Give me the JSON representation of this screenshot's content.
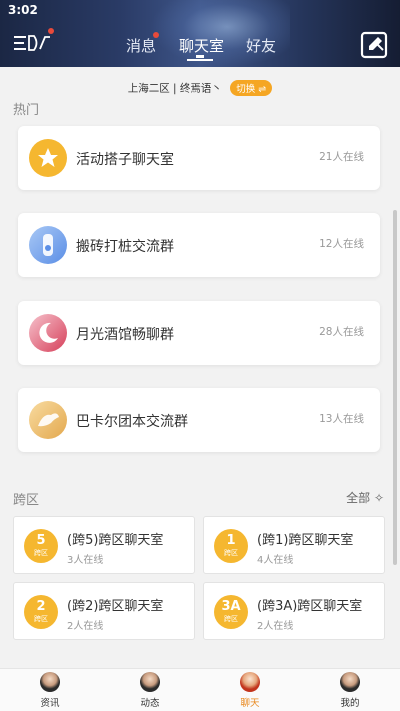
{
  "status_bar": {
    "time": "3:02"
  },
  "header": {
    "tabs": [
      {
        "label": "消息",
        "has_dot": true
      },
      {
        "label": "聊天室",
        "active": true
      },
      {
        "label": "好友"
      }
    ]
  },
  "server": {
    "text": "上海二区 | 终焉语丶",
    "switch_label": "切换 ⇌"
  },
  "hot": {
    "title": "热门",
    "rooms": [
      {
        "name": "活动搭子聊天室",
        "online": "21人在线",
        "icon": "star-icon"
      },
      {
        "name": "搬砖打桩交流群",
        "online": "12人在线",
        "icon": "potion-icon"
      },
      {
        "name": "月光酒馆畅聊群",
        "online": "28人在线",
        "icon": "moon-icon"
      },
      {
        "name": "巴卡尔团本交流群",
        "online": "13人在线",
        "icon": "dragon-icon"
      }
    ]
  },
  "cross": {
    "title": "跨区",
    "see_all": "全部 ✧",
    "rooms": [
      {
        "badge": "5",
        "badge_sub": "跨区",
        "name": "(跨5)跨区聊天室",
        "online": "3人在线"
      },
      {
        "badge": "1",
        "badge_sub": "跨区",
        "name": "(跨1)跨区聊天室",
        "online": "4人在线"
      },
      {
        "badge": "2",
        "badge_sub": "跨区",
        "name": "(跨2)跨区聊天室",
        "online": "2人在线"
      },
      {
        "badge": "3A",
        "badge_sub": "跨区",
        "name": "(跨3A)跨区聊天室",
        "online": "2人在线"
      }
    ]
  },
  "bottom_nav": [
    {
      "label": "资讯"
    },
    {
      "label": "动态"
    },
    {
      "label": "聊天",
      "active": true
    },
    {
      "label": "我的"
    }
  ],
  "colors": {
    "accent": "#f5b730",
    "active_nav": "#e8891f",
    "dot": "#e84a3b"
  }
}
